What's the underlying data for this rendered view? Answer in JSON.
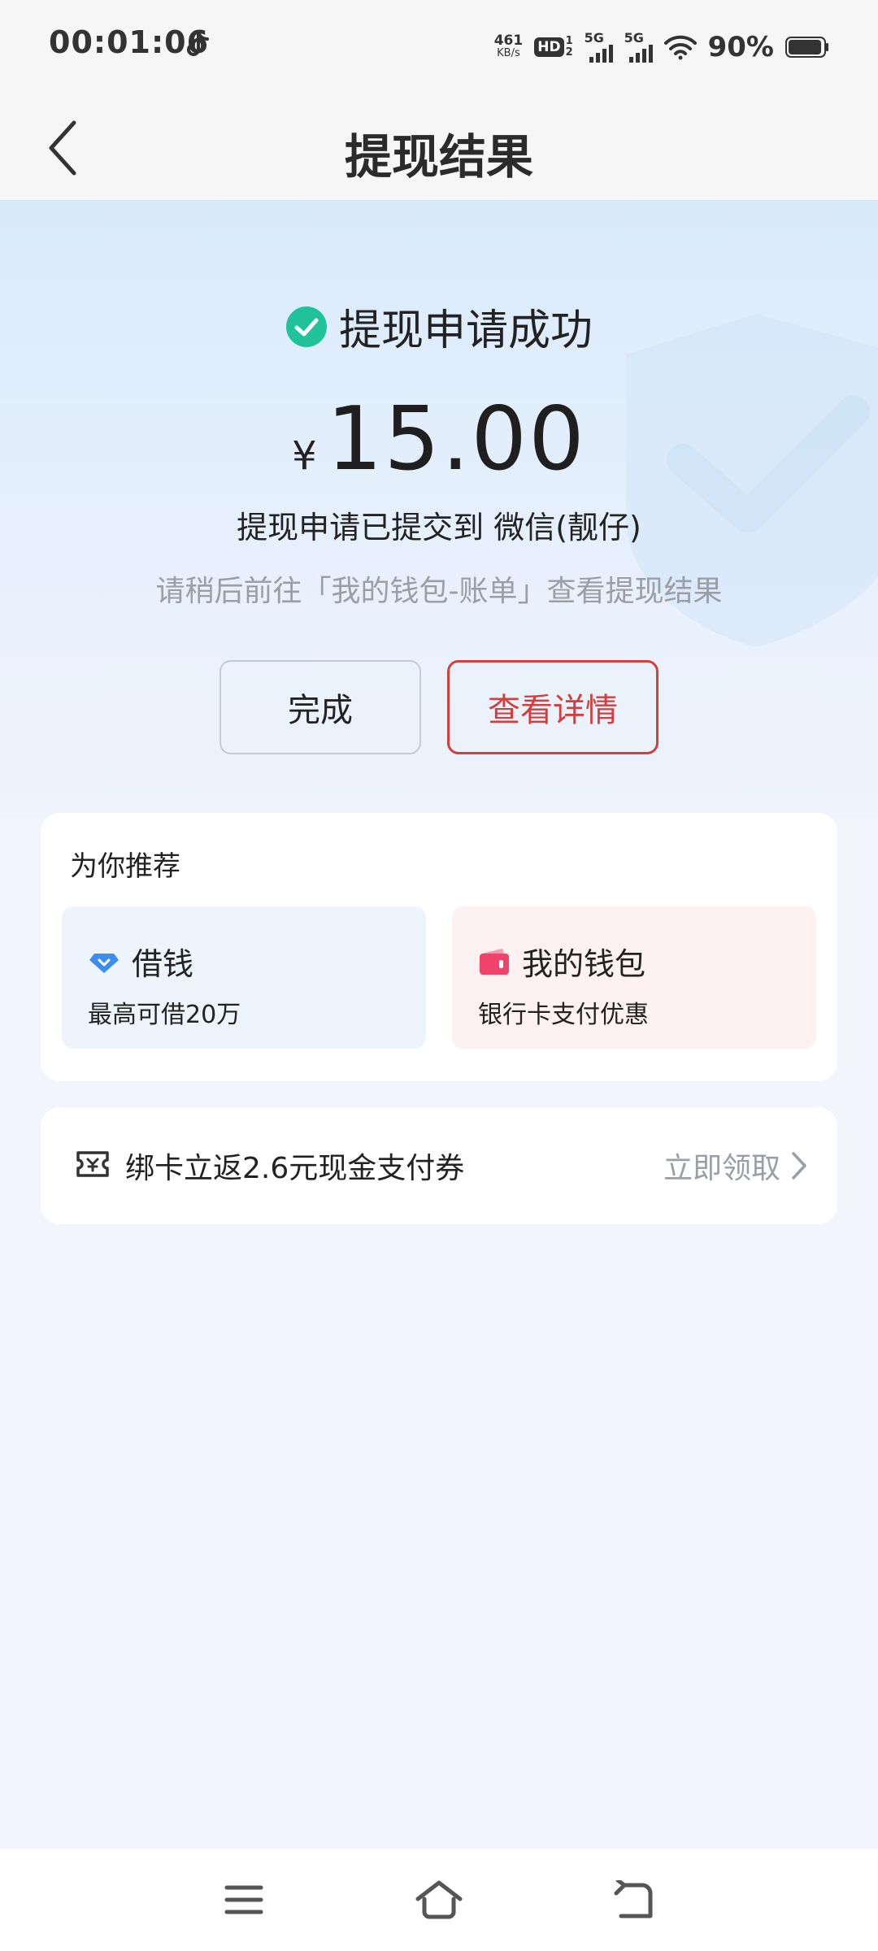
{
  "status_bar": {
    "time": "00:01:06",
    "net_speed": "461",
    "net_unit": "KB/s",
    "hd_label": "HD",
    "hd_sub_top": "1",
    "hd_sub_bottom": "2",
    "signal1_tag": "5G",
    "signal2_tag": "5G",
    "battery": "90%"
  },
  "nav": {
    "title": "提现结果"
  },
  "result": {
    "status": "提现申请成功",
    "currency": "¥",
    "amount": "15.00",
    "submitted_to": "提现申请已提交到 微信(靓仔)",
    "hint": "请稍后前往「我的钱包-账单」查看提现结果"
  },
  "buttons": {
    "done": "完成",
    "view_details": "查看详情"
  },
  "recommend": {
    "title": "为你推荐",
    "items": [
      {
        "title": "借钱",
        "subtitle": "最高可借20万"
      },
      {
        "title": "我的钱包",
        "subtitle": "银行卡支付优惠"
      }
    ]
  },
  "coupon": {
    "text": "绑卡立返2.6元现金支付券",
    "action": "立即领取"
  },
  "colors": {
    "accent_red": "#d0403f",
    "success_green": "#20c29a",
    "loan_blue": "#3b8ef0",
    "wallet_pink": "#f0436b"
  }
}
